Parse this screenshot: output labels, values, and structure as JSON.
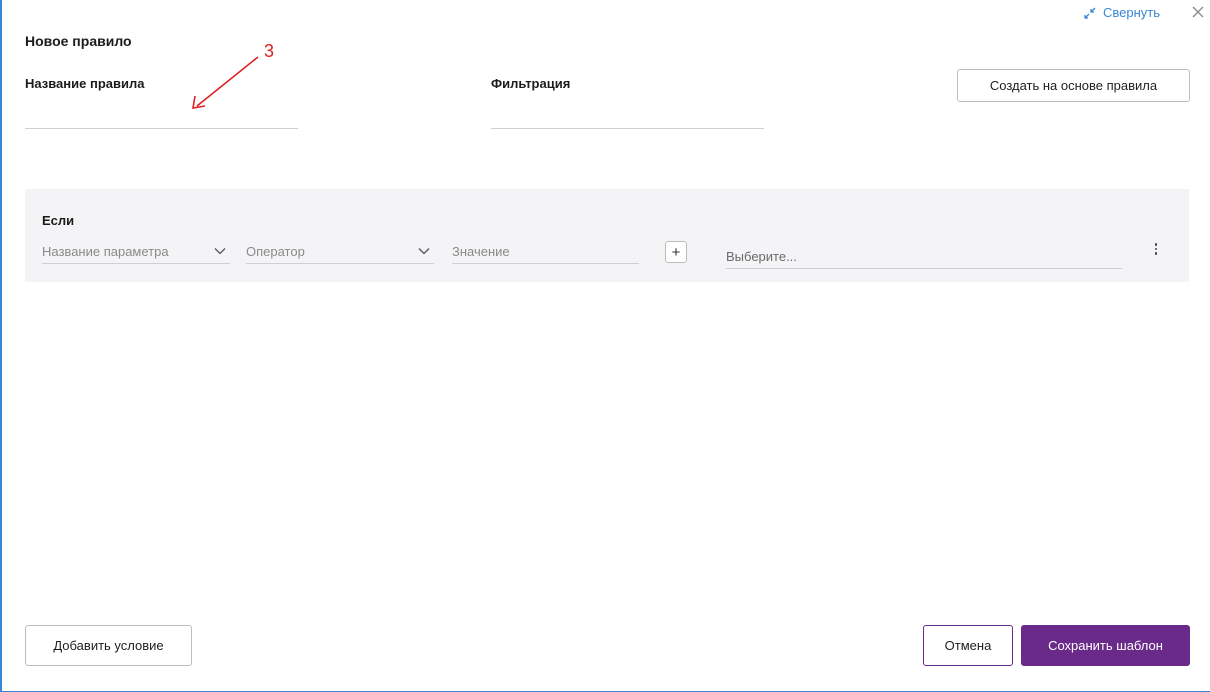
{
  "window": {
    "collapse_label": "Свернуть",
    "close_icon": "close-icon",
    "collapse_icon": "collapse-arrows-icon"
  },
  "form": {
    "title": "Новое правило",
    "rule_name_label": "Название правила",
    "rule_name_value": "",
    "filter_label": "Фильтрация",
    "filter_value": "",
    "create_from_rule_label": "Создать на основе правила"
  },
  "condition": {
    "if_label": "Если",
    "param_placeholder": "Название параметра",
    "operator_placeholder": "Оператор",
    "value_placeholder": "Значение",
    "plus_label": "+",
    "select_placeholder": "Выберите..."
  },
  "footer": {
    "add_condition_label": "Добавить условие",
    "cancel_label": "Отмена",
    "save_label": "Сохранить шаблон"
  },
  "annotation": {
    "number": "3",
    "color": "#e02020"
  },
  "colors": {
    "accent": "#6a2a8a",
    "link": "#3a86d6"
  }
}
